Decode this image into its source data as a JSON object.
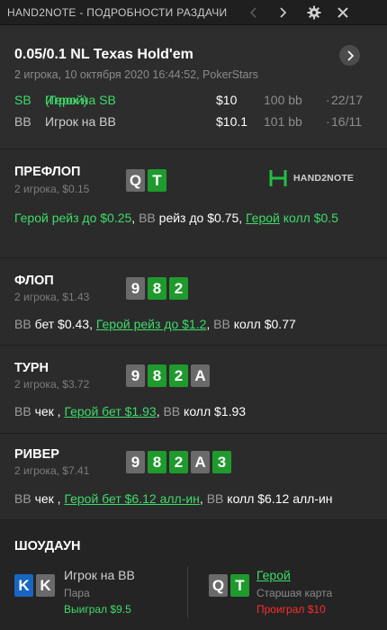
{
  "window": {
    "title": "HAND2NOTE - ПОДРОБНОСТИ РАЗДАЧИ",
    "icons": [
      "chevron-left-icon",
      "chevron-right-icon",
      "gear-icon",
      "close-icon"
    ]
  },
  "summary": {
    "game": "0.05/0.1 NL Texas Hold'em",
    "info": "2 игрока, 10 октября 2020 16:44:52, PokerStars",
    "players": [
      {
        "pos": "SB",
        "name": "Игрок на SB",
        "hero_tag": " (Герой)",
        "money": "$10",
        "bb": "100 bb",
        "dot": "·",
        "stat": "22/17"
      },
      {
        "pos": "BB",
        "name": "Игрок на BB",
        "hero_tag": "",
        "money": "$10.1",
        "bb": "101 bb",
        "dot": "·",
        "stat": "16/11"
      }
    ]
  },
  "logo": {
    "text": "HAND2NOTE"
  },
  "streets": [
    {
      "name": "ПРЕФЛОП",
      "sub": "2 игрока, $0.15",
      "cards": [
        {
          "rank": "Q",
          "suit": "spades",
          "color": "gray"
        },
        {
          "rank": "T",
          "suit": "clubs",
          "color": "green"
        }
      ],
      "actions": [
        {
          "text": "Герой рейз до $0.25",
          "style": "gr"
        },
        {
          "text": ", ",
          "style": ""
        },
        {
          "text": "BB",
          "style": "bb"
        },
        {
          "text": " рейз до $0.75, ",
          "style": ""
        },
        {
          "text": "Герой",
          "style": "gu"
        },
        {
          "text": " колл $0.5",
          "style": "gr"
        }
      ]
    },
    {
      "name": "ФЛОП",
      "sub": "2 игрока, $1.43",
      "cards": [
        {
          "rank": "9",
          "suit": "spades",
          "color": "gray"
        },
        {
          "rank": "8",
          "suit": "clubs",
          "color": "green"
        },
        {
          "rank": "2",
          "suit": "clubs",
          "color": "green"
        }
      ],
      "actions": [
        {
          "text": "BB",
          "style": "bb"
        },
        {
          "text": " бет $0.43, ",
          "style": ""
        },
        {
          "text": "Герой рейз до $1.2",
          "style": "gu"
        },
        {
          "text": ", ",
          "style": ""
        },
        {
          "text": "BB",
          "style": "bb"
        },
        {
          "text": " колл $0.77",
          "style": ""
        }
      ]
    },
    {
      "name": "ТУРН",
      "sub": "2 игрока, $3.72",
      "cards": [
        {
          "rank": "9",
          "suit": "spades",
          "color": "gray"
        },
        {
          "rank": "8",
          "suit": "clubs",
          "color": "green"
        },
        {
          "rank": "2",
          "suit": "clubs",
          "color": "green"
        },
        {
          "rank": "A",
          "suit": "spades",
          "color": "gray"
        }
      ],
      "actions": [
        {
          "text": "BB",
          "style": "bb"
        },
        {
          "text": " чек , ",
          "style": ""
        },
        {
          "text": "Герой бет $1.93",
          "style": "gu"
        },
        {
          "text": ", ",
          "style": ""
        },
        {
          "text": "BB",
          "style": "bb"
        },
        {
          "text": " колл $1.93",
          "style": ""
        }
      ]
    },
    {
      "name": "РИВЕР",
      "sub": "2 игрока, $7.41",
      "cards": [
        {
          "rank": "9",
          "suit": "spades",
          "color": "gray"
        },
        {
          "rank": "8",
          "suit": "clubs",
          "color": "green"
        },
        {
          "rank": "2",
          "suit": "clubs",
          "color": "green"
        },
        {
          "rank": "A",
          "suit": "spades",
          "color": "gray"
        },
        {
          "rank": "3",
          "suit": "clubs",
          "color": "green"
        }
      ],
      "actions": [
        {
          "text": "BB",
          "style": "bb"
        },
        {
          "text": " чек , ",
          "style": ""
        },
        {
          "text": "Герой бет $6.12 алл-ин",
          "style": "gu"
        },
        {
          "text": ", ",
          "style": ""
        },
        {
          "text": "BB",
          "style": "bb"
        },
        {
          "text": " колл $6.12 алл-ин",
          "style": ""
        }
      ]
    }
  ],
  "showdown": {
    "title": "ШОУДАУН",
    "players": [
      {
        "cards": [
          {
            "rank": "K",
            "suit": "diamonds",
            "color": "blue"
          },
          {
            "rank": "K",
            "suit": "spades",
            "color": "gray"
          }
        ],
        "name": "Игрок на BB",
        "name_style": "plain",
        "hand": "Пара",
        "result": "Выиграл $9.5",
        "result_color": "#3ddc6a"
      },
      {
        "cards": [
          {
            "rank": "Q",
            "suit": "spades",
            "color": "gray"
          },
          {
            "rank": "T",
            "suit": "clubs",
            "color": "green"
          }
        ],
        "name": "Герой",
        "name_style": "link",
        "hand": "Старшая карта",
        "result": "Проиграл $10",
        "result_color": "#ff2b2b"
      }
    ]
  },
  "colors": {
    "background": "#2b2b2b",
    "titlebar": "#1f1f1f",
    "hero_green": "#3ddc6a",
    "card_gray": "#6a6a6a",
    "card_green": "#1f9a2d",
    "card_blue": "#1766c2",
    "loss_red": "#ff2b2b"
  }
}
